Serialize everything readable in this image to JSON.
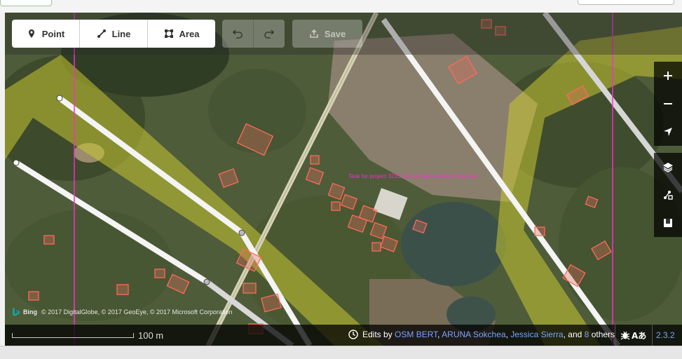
{
  "toolbar": {
    "modes": [
      {
        "label": "Point",
        "icon": "point-icon"
      },
      {
        "label": "Line",
        "icon": "line-icon"
      },
      {
        "label": "Area",
        "icon": "area-icon"
      }
    ],
    "undo_icon": "undo-icon",
    "redo_icon": "redo-icon",
    "save_label": "Save"
  },
  "map_controls": [
    "zoom-in-icon",
    "zoom-out-icon",
    "geolocate-icon",
    "layers-icon",
    "map-data-icon",
    "help-icon"
  ],
  "map": {
    "notice": "Task for project 3233. Do not edit outside of the box!",
    "imagery_provider": "Bing",
    "imagery_attribution": "© 2017 DigitalGlobe, © 2017 GeoEye, © 2017 Microsoft Corporation"
  },
  "footer": {
    "scale_label": "100 m",
    "edits_by": "Edits by",
    "contributors": [
      "OSM BERT",
      "ARUNA Sokchea",
      "Jessica Sierra"
    ],
    "sep1": ",",
    "sep2": ",",
    "and": ", and",
    "others_count": "8",
    "others": "others",
    "version": "2.3.2"
  },
  "colors": {
    "task_boundary": "#ff2bd0",
    "buildings": "#e06e5f",
    "highlight_area": "#c8c832",
    "link": "#7aa3ff"
  }
}
